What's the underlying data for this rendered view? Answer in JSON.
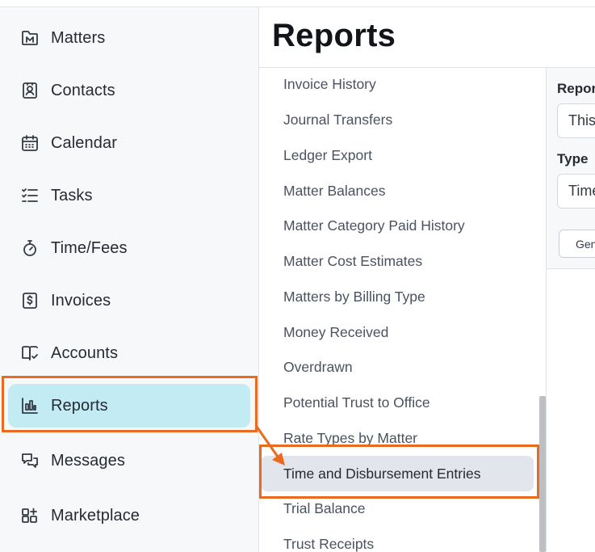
{
  "sidebar": {
    "items": [
      {
        "label": "Matters",
        "icon": "matters-icon"
      },
      {
        "label": "Contacts",
        "icon": "contacts-icon"
      },
      {
        "label": "Calendar",
        "icon": "calendar-icon"
      },
      {
        "label": "Tasks",
        "icon": "tasks-icon"
      },
      {
        "label": "Time/Fees",
        "icon": "stopwatch-icon"
      },
      {
        "label": "Invoices",
        "icon": "invoice-dollar-icon"
      },
      {
        "label": "Accounts",
        "icon": "book-check-icon"
      },
      {
        "label": "Reports",
        "icon": "bar-chart-icon",
        "active": true
      },
      {
        "label": "Messages",
        "icon": "chat-bubbles-icon"
      },
      {
        "label": "Marketplace",
        "icon": "grid-plus-icon"
      }
    ]
  },
  "header": {
    "title": "Reports"
  },
  "reports": {
    "items": [
      {
        "label": "Invoice History"
      },
      {
        "label": "Journal Transfers"
      },
      {
        "label": "Ledger Export"
      },
      {
        "label": "Matter Balances"
      },
      {
        "label": "Matter Category Paid History"
      },
      {
        "label": "Matter Cost Estimates"
      },
      {
        "label": "Matters by Billing Type"
      },
      {
        "label": "Money Received"
      },
      {
        "label": "Overdrawn"
      },
      {
        "label": "Potential Trust to Office"
      },
      {
        "label": "Rate Types by Matter"
      },
      {
        "label": "Time and Disbursement Entries",
        "active": true
      },
      {
        "label": "Trial Balance"
      },
      {
        "label": "Trust Receipts"
      }
    ]
  },
  "options": {
    "period_label": "Report Period",
    "period_value": "This",
    "type_label": "Type",
    "type_value": "Time",
    "generate_button": "Generate"
  },
  "colors": {
    "highlight": "#ea6a1f",
    "active_nav": "#c2ebf3",
    "active_report": "#e2e6ec"
  }
}
